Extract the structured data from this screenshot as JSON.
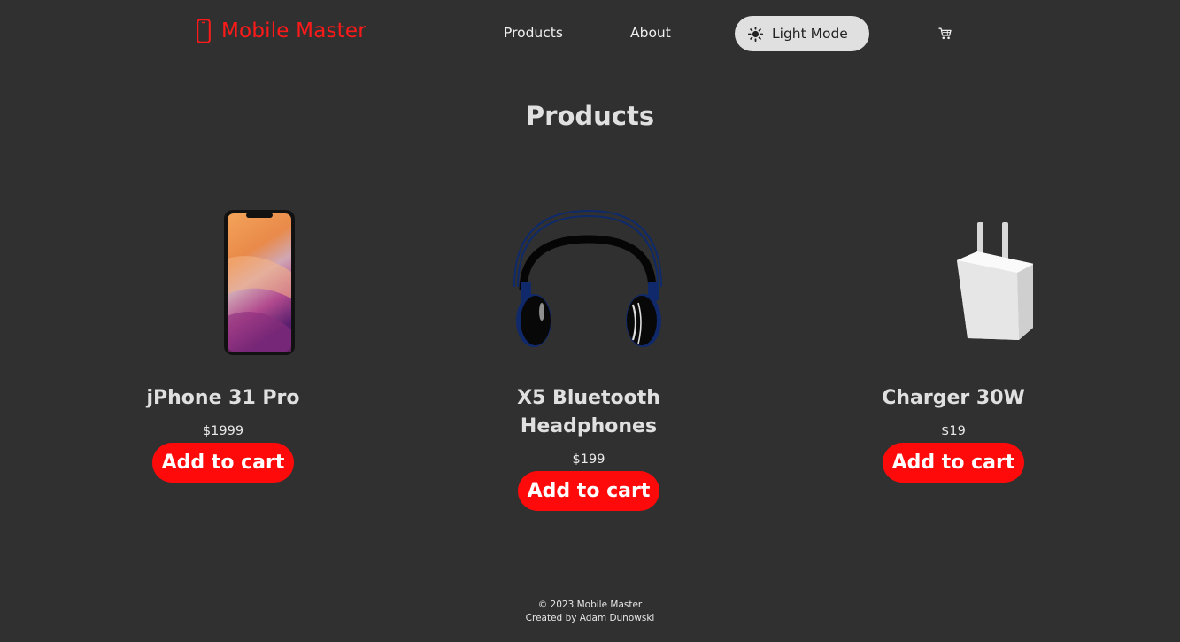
{
  "header": {
    "brand": "Mobile Master",
    "nav": {
      "products": "Products",
      "about": "About"
    },
    "theme_toggle": "Light Mode",
    "cart_icon": "cart-icon"
  },
  "main": {
    "title": "Products",
    "products": [
      {
        "name": "jPhone 31 Pro",
        "price": "$1999",
        "button": "Add to cart",
        "image": "smartphone"
      },
      {
        "name": "X5 Bluetooth Headphones",
        "price": "$199",
        "button": "Add to cart",
        "image": "headphones"
      },
      {
        "name": "Charger 30W",
        "price": "$19",
        "button": "Add to cart",
        "image": "charger"
      }
    ]
  },
  "footer": {
    "copyright": "© 2023 Mobile Master",
    "credit": "Created by Adam Dunowski"
  },
  "colors": {
    "background": "#303030",
    "accent": "#ff0a0a",
    "toggle_bg": "#e0e0e0",
    "text": "#e6e6e6"
  }
}
